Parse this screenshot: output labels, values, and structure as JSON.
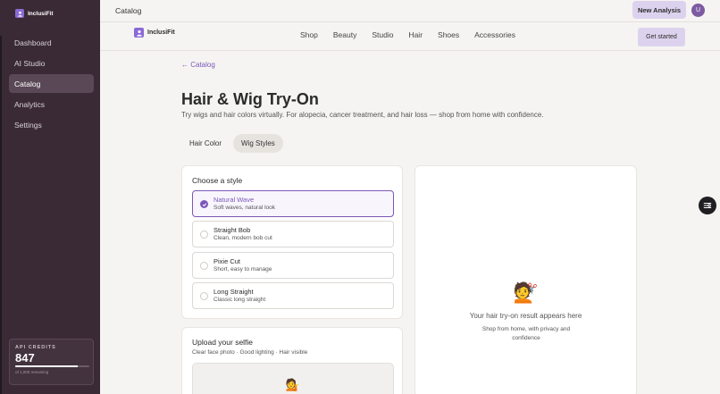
{
  "sidebar": {
    "brand": "InclusiFit",
    "items": [
      {
        "label": "Dashboard"
      },
      {
        "label": "AI Studio"
      },
      {
        "label": "Catalog"
      },
      {
        "label": "Analytics"
      },
      {
        "label": "Settings"
      }
    ],
    "credits": {
      "title": "API CREDITS",
      "value": "847",
      "remaining": "of 1,000 remaining",
      "fraction": 0.847
    }
  },
  "topbar": {
    "title": "Catalog",
    "new_analysis": "New Analysis",
    "avatar_initial": "U"
  },
  "site": {
    "brand": "InclusiFit",
    "nav": [
      "Shop",
      "Beauty",
      "Studio",
      "Hair",
      "Shoes",
      "Accessories"
    ],
    "get_started": "Get started"
  },
  "main": {
    "back_link": "← Catalog",
    "title": "Hair & Wig Try-On",
    "subtitle": "Try wigs and hair colors virtually. For alopecia, cancer treatment, and hair loss — shop from home with confidence.",
    "tabs": [
      {
        "label": "Hair Color",
        "active": false
      },
      {
        "label": "Wig Styles",
        "active": true
      }
    ],
    "style_panel": {
      "heading": "Choose a style",
      "options": [
        {
          "name": "Natural Wave",
          "desc": "Soft waves, natural look",
          "selected": true
        },
        {
          "name": "Straight Bob",
          "desc": "Clean, modern bob cut",
          "selected": false
        },
        {
          "name": "Pixie Cut",
          "desc": "Short, easy to manage",
          "selected": false
        },
        {
          "name": "Long Straight",
          "desc": "Classic long straight",
          "selected": false
        }
      ]
    },
    "result_panel": {
      "emoji": "💇",
      "title": "Your hair try-on result appears here",
      "subtitle": "Shop from home, with privacy and confidence"
    },
    "upload_panel": {
      "title": "Upload your selfie",
      "subtitle": "Clear face photo · Good lighting · Hair visible",
      "emoji": "💁"
    }
  },
  "colors": {
    "accent": "#7b58b8",
    "sidebar_bg": "#3a2a36",
    "button_bg": "#ddd2ee"
  },
  "icons": {
    "brand_logo": "person-icon",
    "fab": "sliders-icon"
  }
}
